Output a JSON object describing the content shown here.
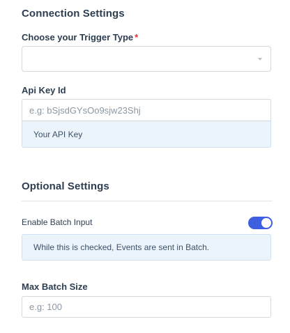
{
  "connection": {
    "section_title": "Connection Settings",
    "trigger_label": "Choose your Trigger Type",
    "required_mark": "*",
    "trigger_value": "",
    "api_key_label": "Api Key Id",
    "api_key_placeholder": "e.g: bSjsdGYsOo9sjw23Shj",
    "api_key_hint": "Your API Key"
  },
  "optional": {
    "section_title": "Optional Settings",
    "batch_toggle_label": "Enable Batch Input",
    "batch_toggle_on": true,
    "batch_hint": "While this is checked, Events are sent in Batch.",
    "max_batch_label": "Max Batch Size",
    "max_batch_placeholder": "e.g: 100"
  },
  "colors": {
    "accent": "#3e5fe0",
    "required": "#e3313c",
    "hint_background": "#ecf4fb"
  },
  "icons": {
    "select_caret": "chevron-down-icon"
  }
}
